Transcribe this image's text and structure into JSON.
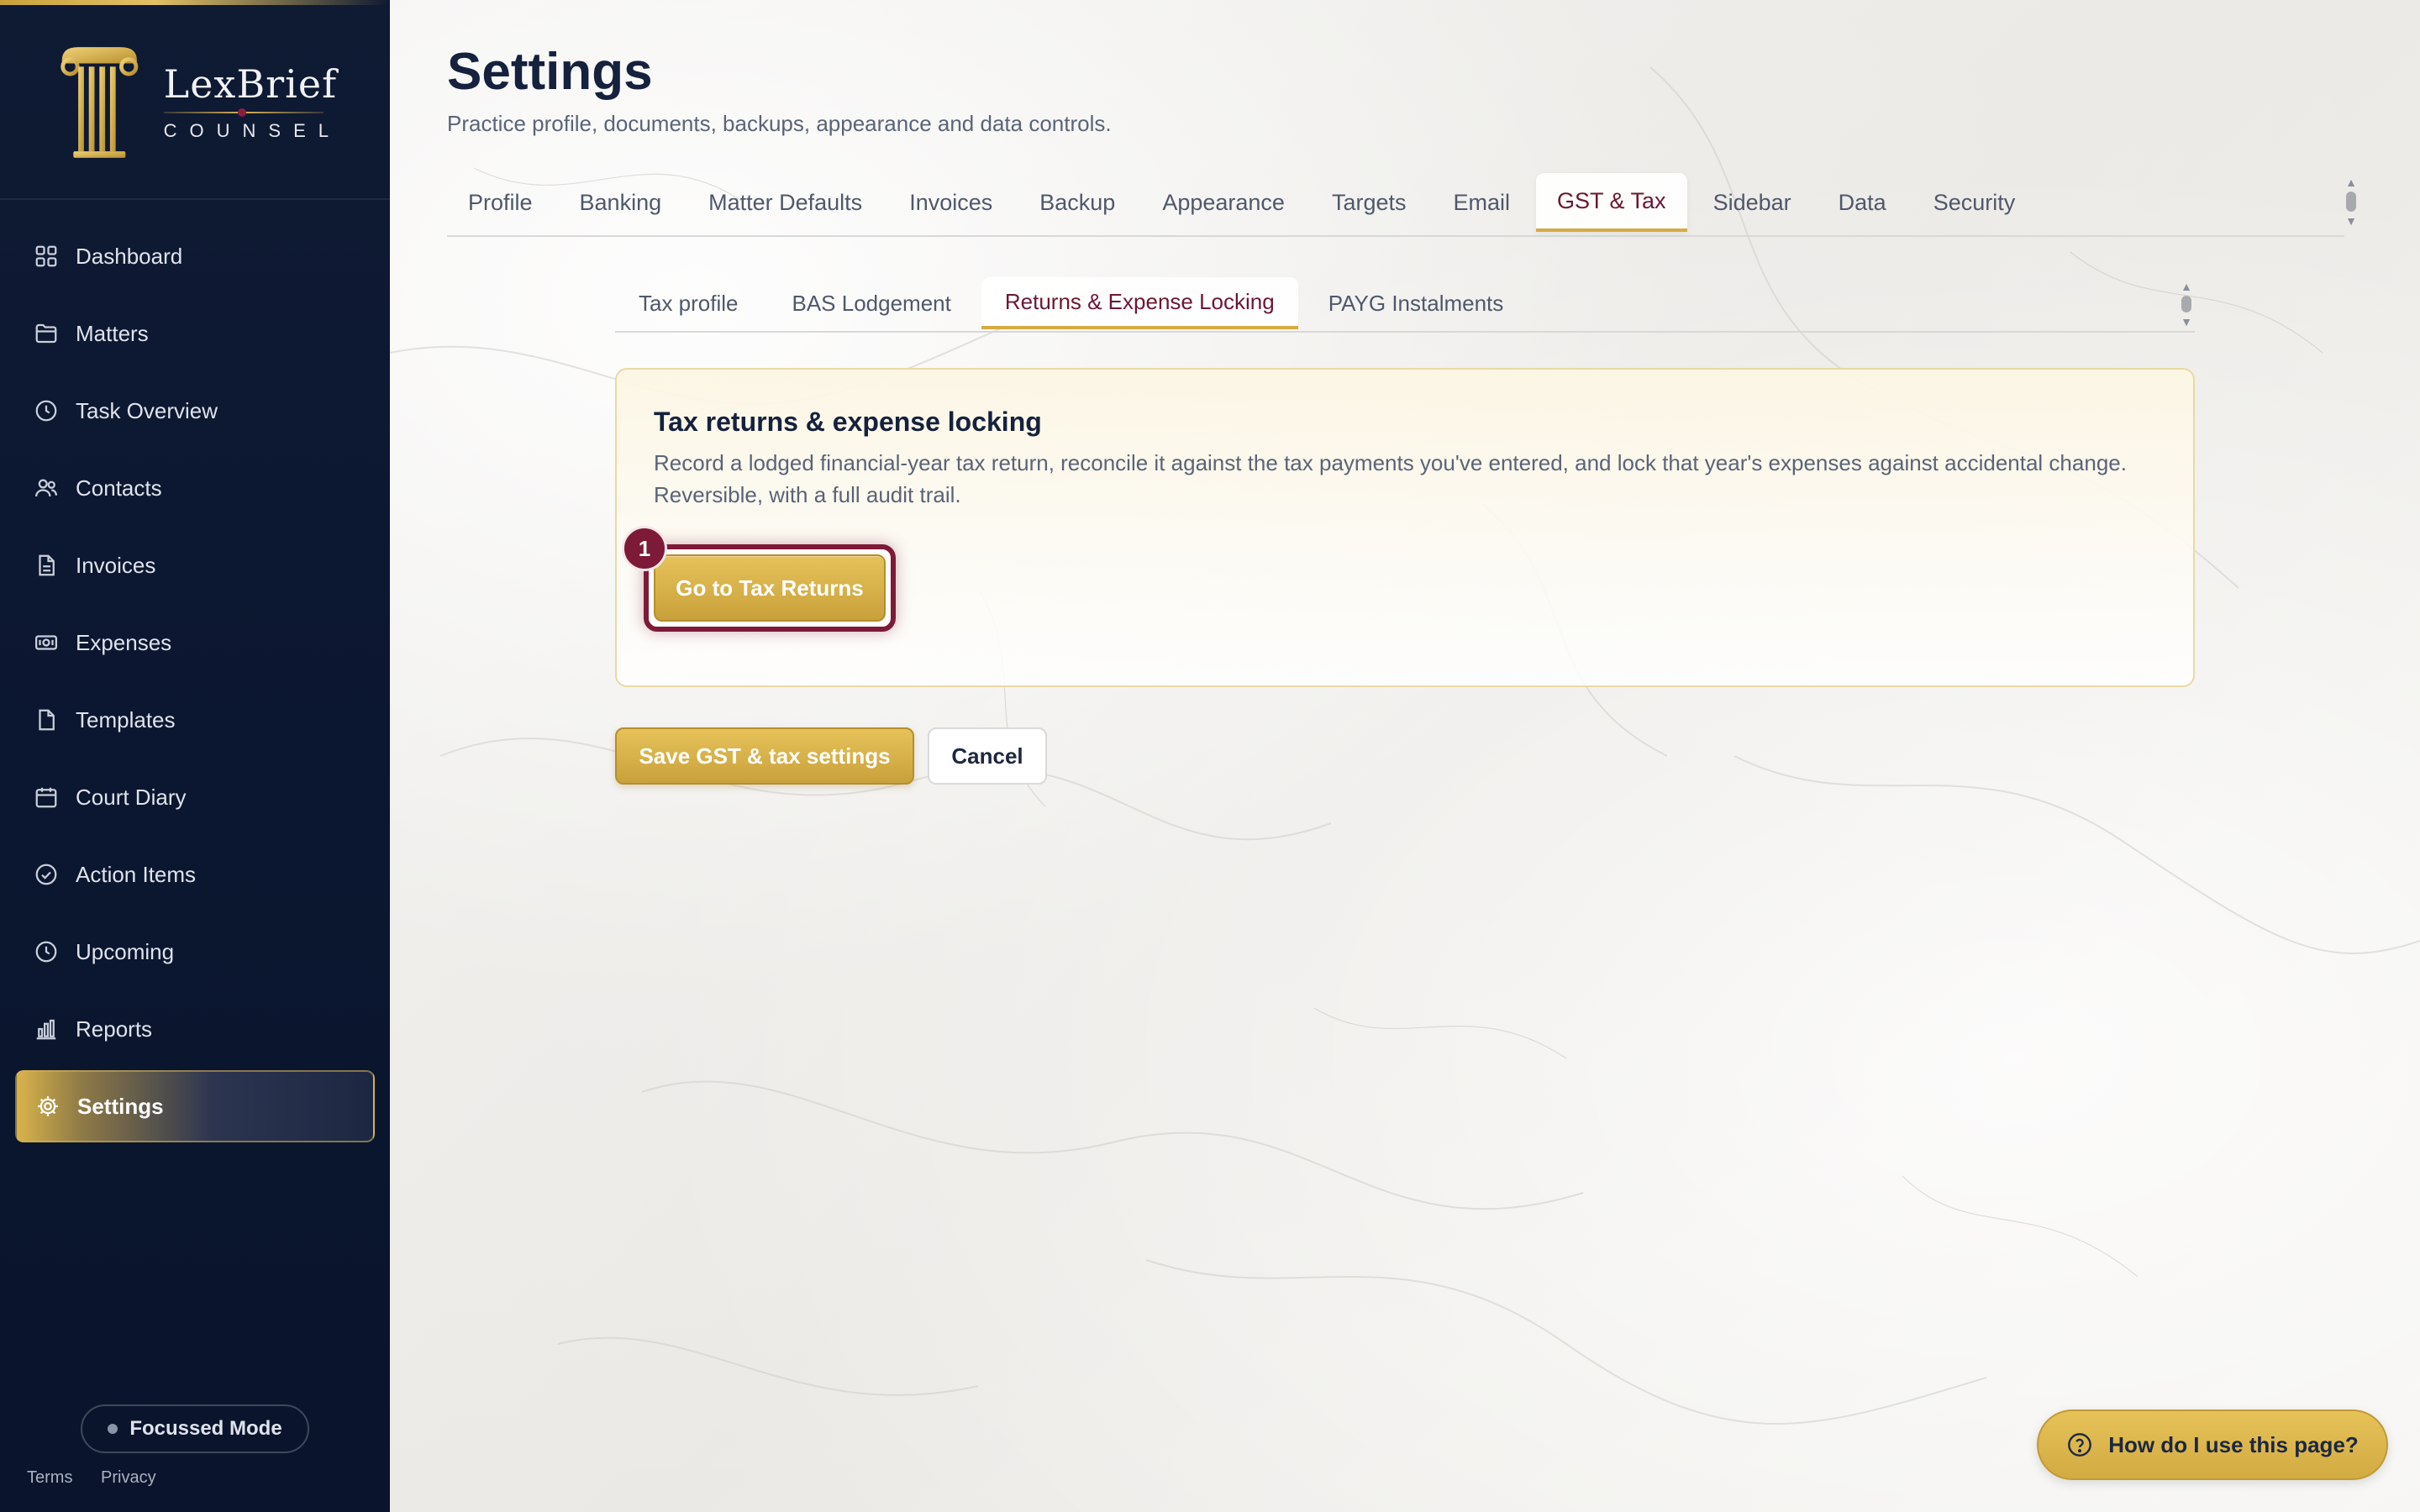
{
  "brand": {
    "name": "LexBrief",
    "subtitle": "COUNSEL",
    "accent_gold": "#d6b256",
    "accent_burgundy": "#7d1a38"
  },
  "sidebar": {
    "items": [
      {
        "label": "Dashboard",
        "icon": "grid-icon"
      },
      {
        "label": "Matters",
        "icon": "folder-icon"
      },
      {
        "label": "Task Overview",
        "icon": "clock-icon"
      },
      {
        "label": "Contacts",
        "icon": "users-icon"
      },
      {
        "label": "Invoices",
        "icon": "file-text-icon"
      },
      {
        "label": "Expenses",
        "icon": "banknote-icon"
      },
      {
        "label": "Templates",
        "icon": "file-icon"
      },
      {
        "label": "Court Diary",
        "icon": "calendar-icon"
      },
      {
        "label": "Action Items",
        "icon": "check-circle-icon"
      },
      {
        "label": "Upcoming",
        "icon": "clock-icon"
      },
      {
        "label": "Reports",
        "icon": "bar-chart-icon"
      },
      {
        "label": "Settings",
        "icon": "gear-icon",
        "active": true
      }
    ],
    "focus_mode_label": "Focussed Mode",
    "footer": {
      "terms": "Terms",
      "privacy": "Privacy"
    }
  },
  "header": {
    "title": "Settings",
    "subtitle": "Practice profile, documents, backups, appearance and data controls."
  },
  "tabs": [
    {
      "label": "Profile"
    },
    {
      "label": "Banking"
    },
    {
      "label": "Matter Defaults"
    },
    {
      "label": "Invoices"
    },
    {
      "label": "Backup"
    },
    {
      "label": "Appearance"
    },
    {
      "label": "Targets"
    },
    {
      "label": "Email"
    },
    {
      "label": "GST & Tax",
      "active": true
    },
    {
      "label": "Sidebar"
    },
    {
      "label": "Data"
    },
    {
      "label": "Security"
    }
  ],
  "subtabs": [
    {
      "label": "Tax profile"
    },
    {
      "label": "BAS Lodgement"
    },
    {
      "label": "Returns & Expense Locking",
      "active": true
    },
    {
      "label": "PAYG Instalments"
    }
  ],
  "card": {
    "title": "Tax returns & expense locking",
    "description": "Record a lodged financial-year tax return, reconcile it against the tax payments you've entered, and lock that year's expenses against accidental change. Reversible, with a full audit trail.",
    "button_label": "Go to Tax Returns",
    "step_badge": "1"
  },
  "actions": {
    "save_label": "Save GST & tax settings",
    "cancel_label": "Cancel"
  },
  "help": {
    "label": "How do I use this page?"
  }
}
